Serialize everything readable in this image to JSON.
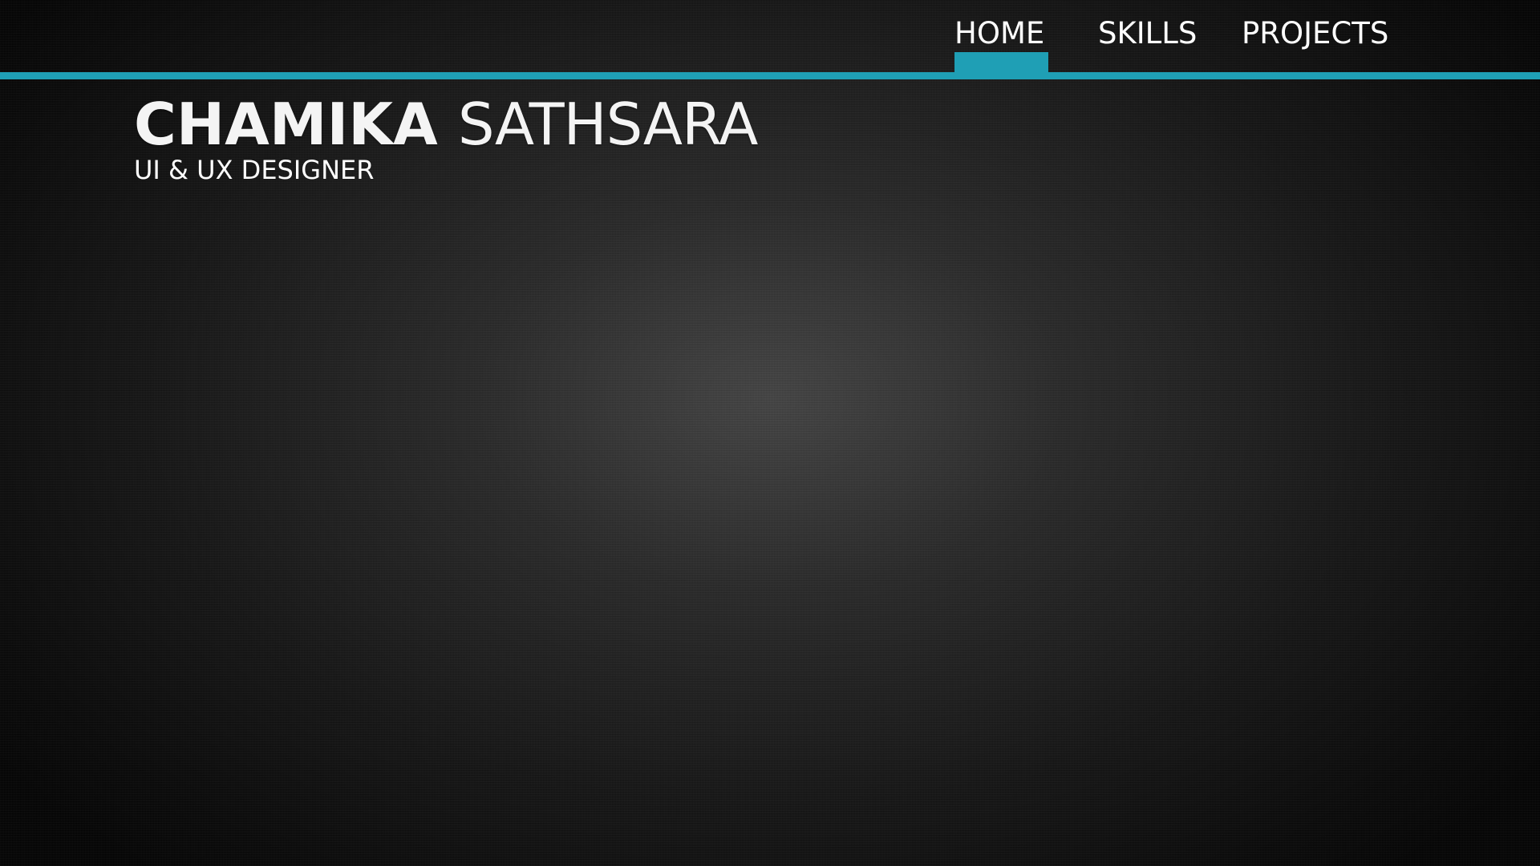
{
  "theme": {
    "accent": "#1f9fb5",
    "background": "#141414",
    "text": "#ffffff"
  },
  "nav": {
    "items": [
      {
        "label": "HOME",
        "active": true
      },
      {
        "label": "SKILLS",
        "active": false
      },
      {
        "label": "PROJECTS",
        "active": false
      }
    ]
  },
  "hero": {
    "first_name": "CHAMIKA",
    "last_name": "SATHSARA",
    "role": "UI & UX DESIGNER"
  }
}
